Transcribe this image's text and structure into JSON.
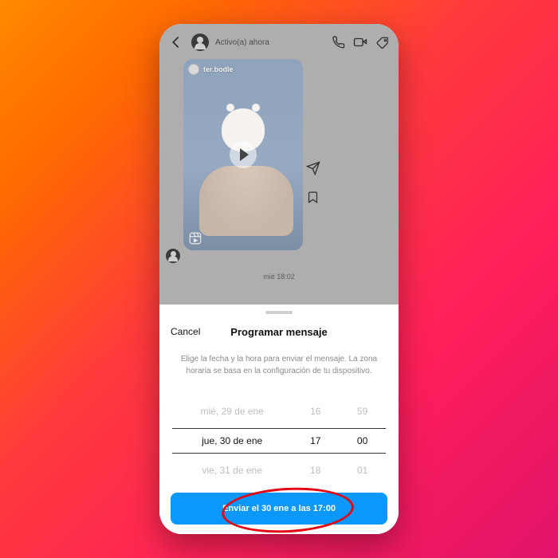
{
  "chat": {
    "status_text": "Activo(a) ahora",
    "reel_username": "ter.bodle",
    "timestamp": "mié 18:02"
  },
  "sheet": {
    "cancel_label": "Cancel",
    "title": "Programar mensaje",
    "description": "Elige la fecha y la hora para enviar el mensaje. La zona horaria se basa en la configuración de tu dispositivo.",
    "picker": {
      "rows": [
        {
          "date": "mié, 29 de ene",
          "hour": "16",
          "minute": "59"
        },
        {
          "date": "jue, 30 de ene",
          "hour": "17",
          "minute": "00"
        },
        {
          "date": "vie, 31 de ene",
          "hour": "18",
          "minute": "01"
        }
      ],
      "selected_index": 1
    },
    "send_button_label": "Enviar el 30 ene a las 17:00"
  },
  "colors": {
    "accent_blue": "#0b98fc",
    "annotation_red": "#e30613"
  }
}
